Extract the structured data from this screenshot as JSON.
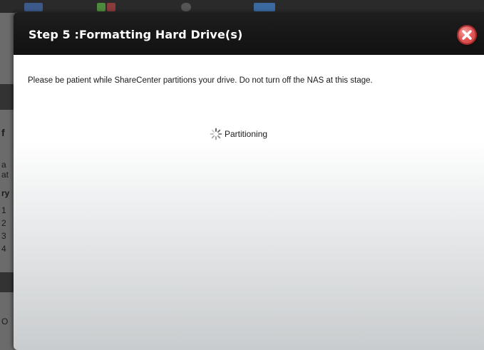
{
  "dialog": {
    "title": "Step 5 :Formatting Hard Drive(s)",
    "message": "Please be patient while ShareCenter partitions your drive. Do not turn off the NAS at this stage.",
    "progress_label": "Partitioning",
    "close_icon": "close-icon",
    "spinner_icon": "spinner-icon"
  },
  "background": {
    "fragments": [
      "f",
      "a",
      "at",
      "ry",
      "1",
      "2",
      "3",
      "4",
      "O"
    ]
  },
  "colors": {
    "header_bg": "#111111",
    "title_text": "#ffffff",
    "close_button": "#d04040",
    "overlay": "#6b6b6b"
  }
}
